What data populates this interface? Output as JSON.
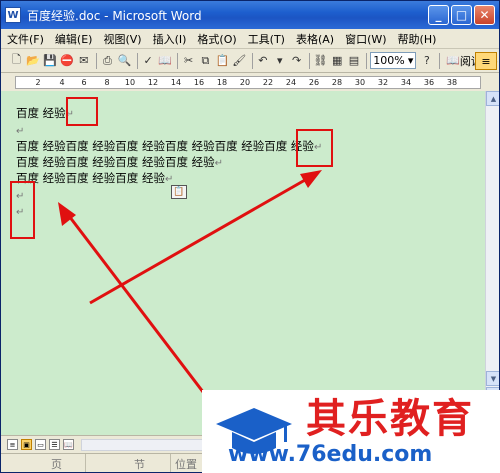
{
  "window": {
    "title": "百度经验.doc - Microsoft Word",
    "app_icon": "W"
  },
  "menu": [
    "文件(F)",
    "编辑(E)",
    "视图(V)",
    "插入(I)",
    "格式(O)",
    "工具(T)",
    "表格(A)",
    "窗口(W)",
    "帮助(H)"
  ],
  "toolbar": {
    "zoom": "100%",
    "read_label": "阅读(R)"
  },
  "ruler": [
    "2",
    "4",
    "6",
    "8",
    "10",
    "12",
    "14",
    "16",
    "18",
    "20",
    "22",
    "24",
    "26",
    "28",
    "30",
    "32",
    "34",
    "36",
    "38"
  ],
  "document": {
    "line1": "百度 经验",
    "line3": "百度 经验百度 经验百度 经验百度 经验百度 经验百度 经验",
    "line4": "百度 经验百度 经验百度 经验百度 经验",
    "line5": "百度 经验百度 经验百度 经验",
    "para_mark": "↵"
  },
  "status": {
    "page": "页",
    "section": "节",
    "position": "位置"
  },
  "watermark": {
    "brand_cn": "其乐教育",
    "url": "www.76edu.com"
  },
  "colors": {
    "annotation": "#e01010",
    "doc_bg": "#ccebcc",
    "titlebar": "#1d5fce"
  }
}
